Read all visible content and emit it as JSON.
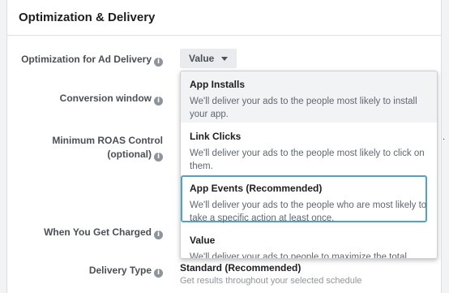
{
  "panel": {
    "title": "Optimization & Delivery"
  },
  "fields": {
    "optimization_label": "Optimization for Ad Delivery",
    "conversion_label": "Conversion window",
    "roas_label_1": "Minimum ROAS Control",
    "roas_label_2": "(optional)",
    "charged_label": "When You Get Charged",
    "delivery_type_label": "Delivery Type"
  },
  "select": {
    "value": "Value"
  },
  "options": [
    {
      "title": "App Installs",
      "desc": "We'll deliver your ads to the people most likely to install your app."
    },
    {
      "title": "Link Clicks",
      "desc": "We'll deliver your ads to the people most likely to click on them."
    },
    {
      "title": "App Events (Recommended)",
      "desc": "We'll deliver your ads to the people who are most likely to take a specific action at least once."
    },
    {
      "title": "Value",
      "desc": "We'll deliver your ads to people to maximize the total"
    }
  ],
  "delivery": {
    "value": "Standard (Recommended)",
    "subtext": "Get results throughout your selected schedule"
  },
  "icons": {
    "info": "info-icon",
    "caret": "caret-down-icon"
  },
  "colors": {
    "highlight_border": "#4fa3c9",
    "hover_bg": "#f2f3f5"
  }
}
